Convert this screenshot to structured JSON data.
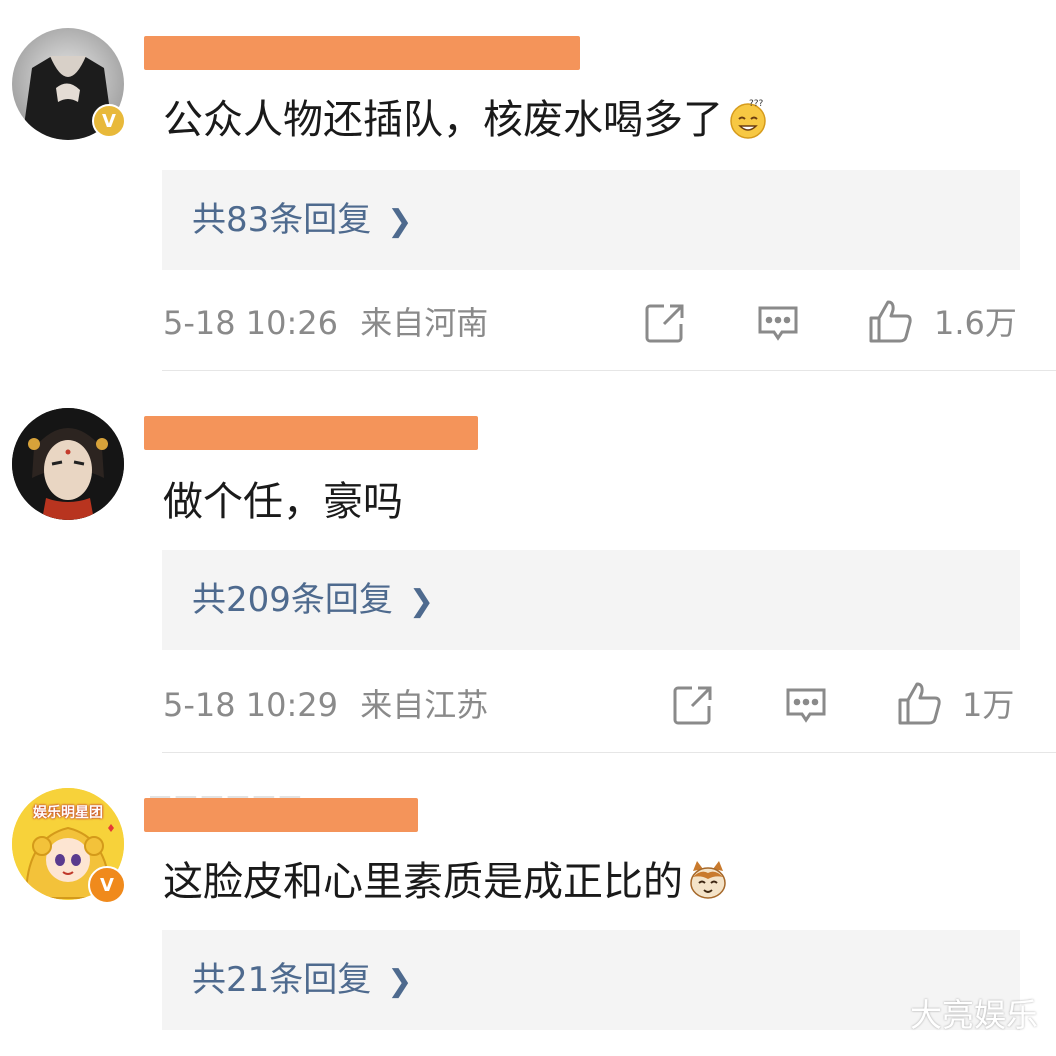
{
  "comments": [
    {
      "text": "公众人物还插队，核废水喝多了",
      "emoji_icon": "dizzy-face-emoji",
      "replies_label": "共83条回复",
      "time": "5-18 10:26",
      "location": "来自河南",
      "likes": "1.6万"
    },
    {
      "text": "做个任，豪吗",
      "replies_label": "共209条回复",
      "time": "5-18 10:29",
      "location": "来自江苏",
      "likes": "1万"
    },
    {
      "text": "这脸皮和心里素质是成正比的",
      "emoji_icon": "cat-face-emoji",
      "avatar_label": "娱乐明星团",
      "replies_label": "共21条回复"
    }
  ],
  "watermark": "大亮娱乐",
  "colors": {
    "reply_link": "#4e6a8e",
    "reply_bg": "#f4f4f4",
    "meta": "#8a8a8a",
    "redaction": "#f4945a",
    "badge_gold": "#e8b93a",
    "badge_orange": "#f08a1c"
  }
}
